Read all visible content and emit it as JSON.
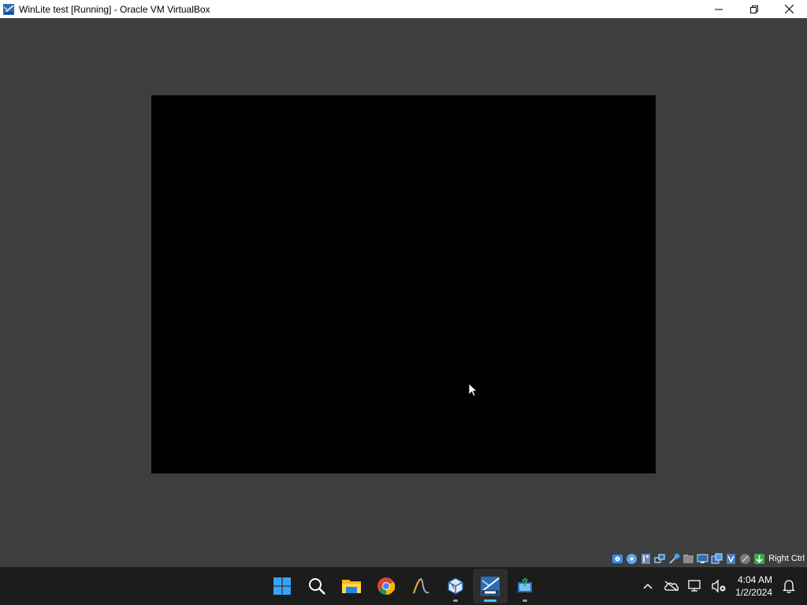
{
  "window": {
    "title": "WinLite test [Running] - Oracle VM VirtualBox"
  },
  "statusbar": {
    "icons": [
      "hard-disk-icon",
      "optical-drive-icon",
      "audio-icon",
      "network-icon",
      "usb-icon",
      "shared-folders-icon",
      "display-icon",
      "recording-icon",
      "cpu-icon",
      "mouse-integration-icon",
      "host-key-icon"
    ],
    "host_key": "Right Ctrl"
  },
  "taskbar": {
    "apps": [
      "start-icon",
      "search-icon",
      "file-explorer-icon",
      "chrome-icon",
      "inkscape-icon",
      "virtualbox-icon",
      "winlite-vm-icon",
      "vm-manager-icon"
    ],
    "tray": {
      "clock_time": "4:04 AM",
      "clock_date": "1/2/2024"
    }
  },
  "colors": {
    "desktop_bg": "#3c3e40",
    "vm_screen": "#000000",
    "taskbar_bg": "#1c1c1c",
    "accent": "#4cc2ff"
  }
}
